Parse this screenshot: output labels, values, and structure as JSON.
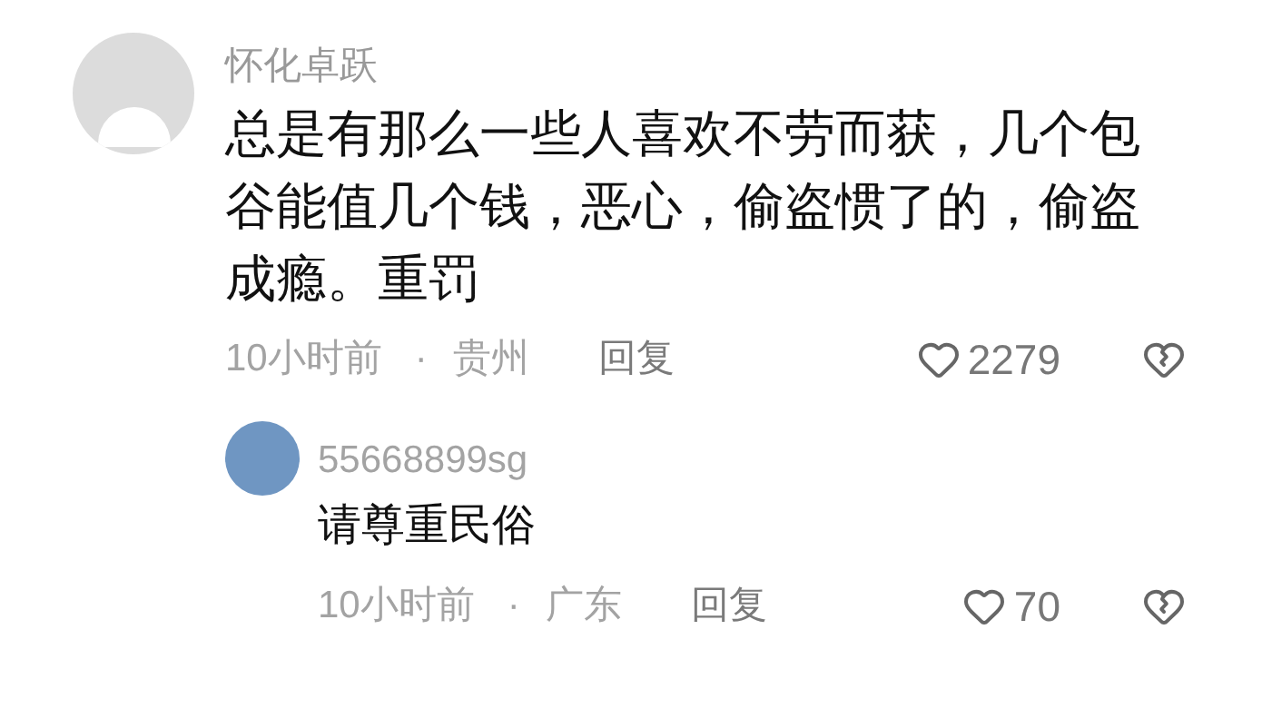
{
  "comments": [
    {
      "username": "怀化卓跃",
      "text": "总是有那么一些人喜欢不劳而获，几个包谷能值几个钱，恶心，偷盗惯了的，偷盗成瘾。重罚",
      "time": "10小时前",
      "separator": "·",
      "location": "贵州",
      "reply_label": "回复",
      "likes": "2279",
      "replies": [
        {
          "username": "55668899sg",
          "text": "请尊重民俗",
          "time": "10小时前",
          "separator": "·",
          "location": "广东",
          "reply_label": "回复",
          "likes": "70"
        }
      ]
    }
  ]
}
